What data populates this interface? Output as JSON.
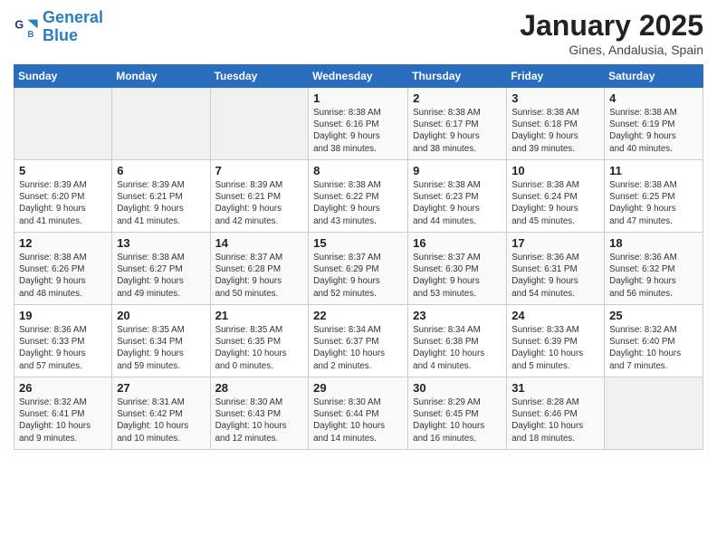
{
  "header": {
    "logo_general": "General",
    "logo_blue": "Blue",
    "title": "January 2025",
    "subtitle": "Gines, Andalusia, Spain"
  },
  "days_of_week": [
    "Sunday",
    "Monday",
    "Tuesday",
    "Wednesday",
    "Thursday",
    "Friday",
    "Saturday"
  ],
  "weeks": [
    [
      {
        "day": "",
        "info": ""
      },
      {
        "day": "",
        "info": ""
      },
      {
        "day": "",
        "info": ""
      },
      {
        "day": "1",
        "info": "Sunrise: 8:38 AM\nSunset: 6:16 PM\nDaylight: 9 hours\nand 38 minutes."
      },
      {
        "day": "2",
        "info": "Sunrise: 8:38 AM\nSunset: 6:17 PM\nDaylight: 9 hours\nand 38 minutes."
      },
      {
        "day": "3",
        "info": "Sunrise: 8:38 AM\nSunset: 6:18 PM\nDaylight: 9 hours\nand 39 minutes."
      },
      {
        "day": "4",
        "info": "Sunrise: 8:38 AM\nSunset: 6:19 PM\nDaylight: 9 hours\nand 40 minutes."
      }
    ],
    [
      {
        "day": "5",
        "info": "Sunrise: 8:39 AM\nSunset: 6:20 PM\nDaylight: 9 hours\nand 41 minutes."
      },
      {
        "day": "6",
        "info": "Sunrise: 8:39 AM\nSunset: 6:21 PM\nDaylight: 9 hours\nand 41 minutes."
      },
      {
        "day": "7",
        "info": "Sunrise: 8:39 AM\nSunset: 6:21 PM\nDaylight: 9 hours\nand 42 minutes."
      },
      {
        "day": "8",
        "info": "Sunrise: 8:38 AM\nSunset: 6:22 PM\nDaylight: 9 hours\nand 43 minutes."
      },
      {
        "day": "9",
        "info": "Sunrise: 8:38 AM\nSunset: 6:23 PM\nDaylight: 9 hours\nand 44 minutes."
      },
      {
        "day": "10",
        "info": "Sunrise: 8:38 AM\nSunset: 6:24 PM\nDaylight: 9 hours\nand 45 minutes."
      },
      {
        "day": "11",
        "info": "Sunrise: 8:38 AM\nSunset: 6:25 PM\nDaylight: 9 hours\nand 47 minutes."
      }
    ],
    [
      {
        "day": "12",
        "info": "Sunrise: 8:38 AM\nSunset: 6:26 PM\nDaylight: 9 hours\nand 48 minutes."
      },
      {
        "day": "13",
        "info": "Sunrise: 8:38 AM\nSunset: 6:27 PM\nDaylight: 9 hours\nand 49 minutes."
      },
      {
        "day": "14",
        "info": "Sunrise: 8:37 AM\nSunset: 6:28 PM\nDaylight: 9 hours\nand 50 minutes."
      },
      {
        "day": "15",
        "info": "Sunrise: 8:37 AM\nSunset: 6:29 PM\nDaylight: 9 hours\nand 52 minutes."
      },
      {
        "day": "16",
        "info": "Sunrise: 8:37 AM\nSunset: 6:30 PM\nDaylight: 9 hours\nand 53 minutes."
      },
      {
        "day": "17",
        "info": "Sunrise: 8:36 AM\nSunset: 6:31 PM\nDaylight: 9 hours\nand 54 minutes."
      },
      {
        "day": "18",
        "info": "Sunrise: 8:36 AM\nSunset: 6:32 PM\nDaylight: 9 hours\nand 56 minutes."
      }
    ],
    [
      {
        "day": "19",
        "info": "Sunrise: 8:36 AM\nSunset: 6:33 PM\nDaylight: 9 hours\nand 57 minutes."
      },
      {
        "day": "20",
        "info": "Sunrise: 8:35 AM\nSunset: 6:34 PM\nDaylight: 9 hours\nand 59 minutes."
      },
      {
        "day": "21",
        "info": "Sunrise: 8:35 AM\nSunset: 6:35 PM\nDaylight: 10 hours\nand 0 minutes."
      },
      {
        "day": "22",
        "info": "Sunrise: 8:34 AM\nSunset: 6:37 PM\nDaylight: 10 hours\nand 2 minutes."
      },
      {
        "day": "23",
        "info": "Sunrise: 8:34 AM\nSunset: 6:38 PM\nDaylight: 10 hours\nand 4 minutes."
      },
      {
        "day": "24",
        "info": "Sunrise: 8:33 AM\nSunset: 6:39 PM\nDaylight: 10 hours\nand 5 minutes."
      },
      {
        "day": "25",
        "info": "Sunrise: 8:32 AM\nSunset: 6:40 PM\nDaylight: 10 hours\nand 7 minutes."
      }
    ],
    [
      {
        "day": "26",
        "info": "Sunrise: 8:32 AM\nSunset: 6:41 PM\nDaylight: 10 hours\nand 9 minutes."
      },
      {
        "day": "27",
        "info": "Sunrise: 8:31 AM\nSunset: 6:42 PM\nDaylight: 10 hours\nand 10 minutes."
      },
      {
        "day": "28",
        "info": "Sunrise: 8:30 AM\nSunset: 6:43 PM\nDaylight: 10 hours\nand 12 minutes."
      },
      {
        "day": "29",
        "info": "Sunrise: 8:30 AM\nSunset: 6:44 PM\nDaylight: 10 hours\nand 14 minutes."
      },
      {
        "day": "30",
        "info": "Sunrise: 8:29 AM\nSunset: 6:45 PM\nDaylight: 10 hours\nand 16 minutes."
      },
      {
        "day": "31",
        "info": "Sunrise: 8:28 AM\nSunset: 6:46 PM\nDaylight: 10 hours\nand 18 minutes."
      },
      {
        "day": "",
        "info": ""
      }
    ]
  ]
}
